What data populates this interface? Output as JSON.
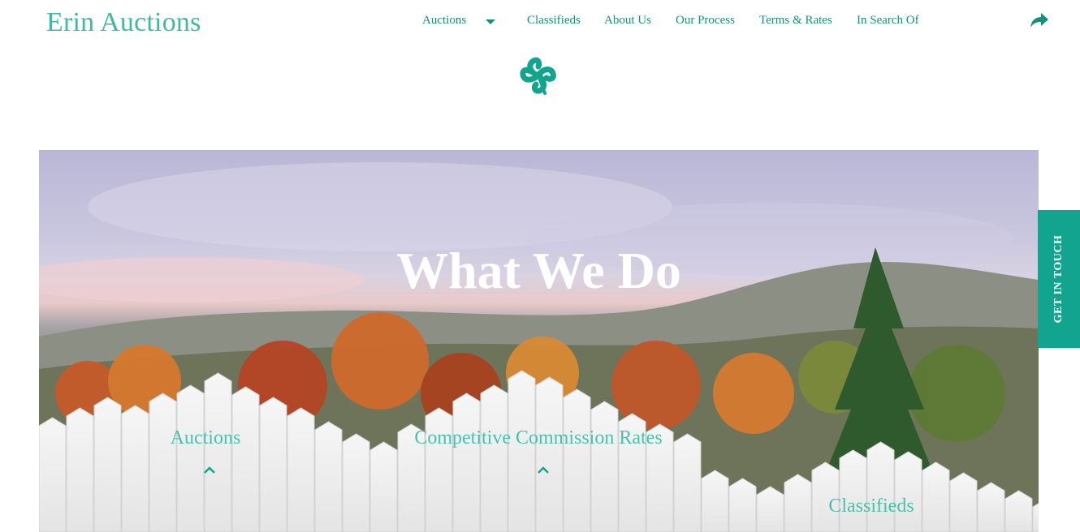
{
  "brand": {
    "name": "Erin Auctions"
  },
  "nav": {
    "items": [
      {
        "label": "Auctions",
        "has_dropdown": true
      },
      {
        "label": "Classifieds"
      },
      {
        "label": "About Us"
      },
      {
        "label": "Our Process"
      },
      {
        "label": "Terms & Rates"
      },
      {
        "label": "In Search Of"
      }
    ],
    "share_icon": "share-arrow-icon",
    "dropdown_icon": "caret-down-icon"
  },
  "emblem_icon": "shamrock-icon",
  "hero": {
    "title": "What We Do",
    "features": [
      {
        "label": "Auctions",
        "icon": "chevron-up-icon"
      },
      {
        "label": "Competitive Commission Rates",
        "icon": "chevron-up-icon"
      },
      {
        "label": "Classifieds"
      }
    ]
  },
  "side_tab": {
    "label": "GET IN TOUCH"
  },
  "colors": {
    "brand": "#3dbaa6",
    "nav_text": "#14907f",
    "accent": "#12a48f",
    "feature_text": "#4cc0ae"
  }
}
